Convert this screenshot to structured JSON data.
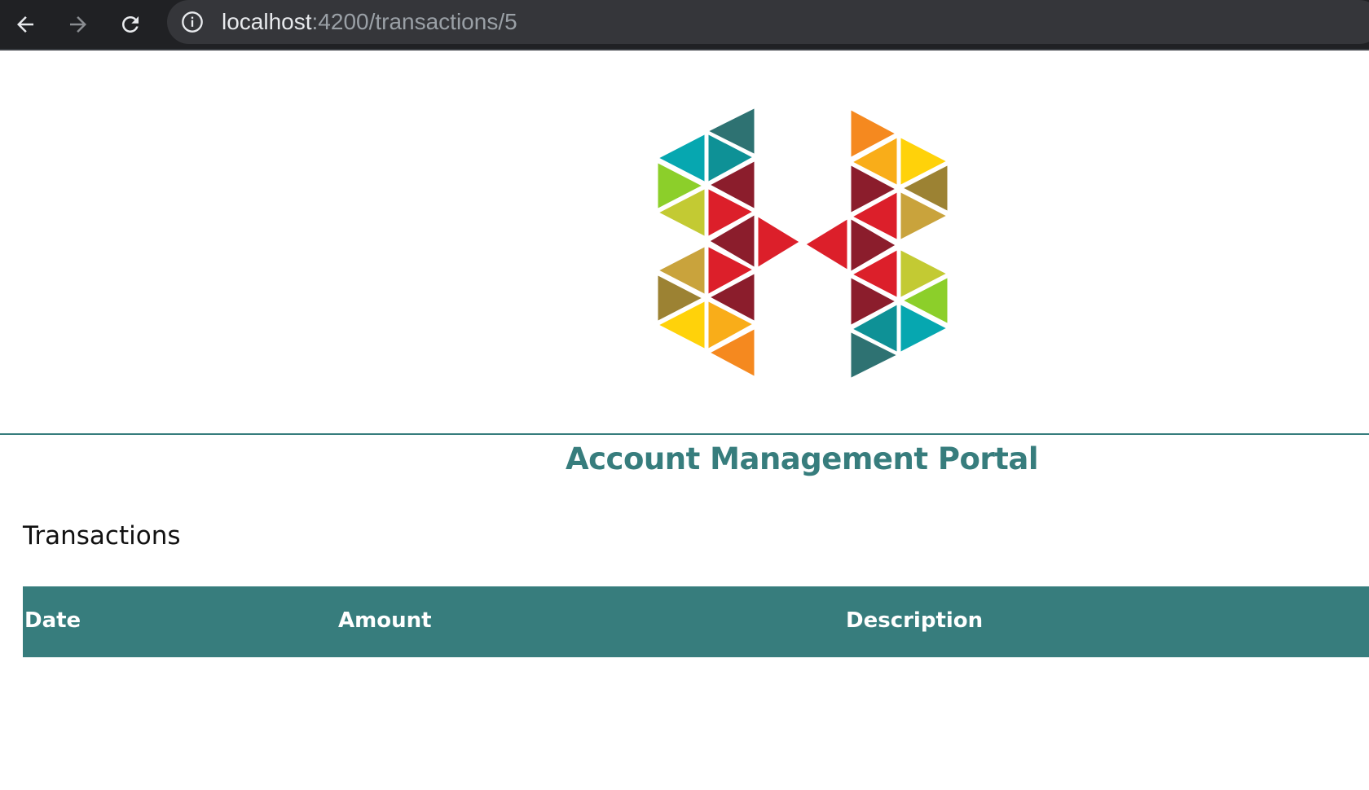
{
  "browser": {
    "url_host": "localhost",
    "url_path": ":4200/transactions/5",
    "icons": [
      "back-arrow-icon",
      "forward-arrow-icon",
      "reload-icon",
      "info-icon"
    ]
  },
  "header": {
    "logo_icon": "h-triangles-logo",
    "title": "Account Management Portal"
  },
  "main": {
    "section_title": "Transactions",
    "table": {
      "columns": [
        "Date",
        "Amount",
        "Description"
      ],
      "rows": []
    }
  },
  "colors": {
    "accent": "#377d7d",
    "browser_chrome": "#202124",
    "omnibox": "#35363a"
  }
}
